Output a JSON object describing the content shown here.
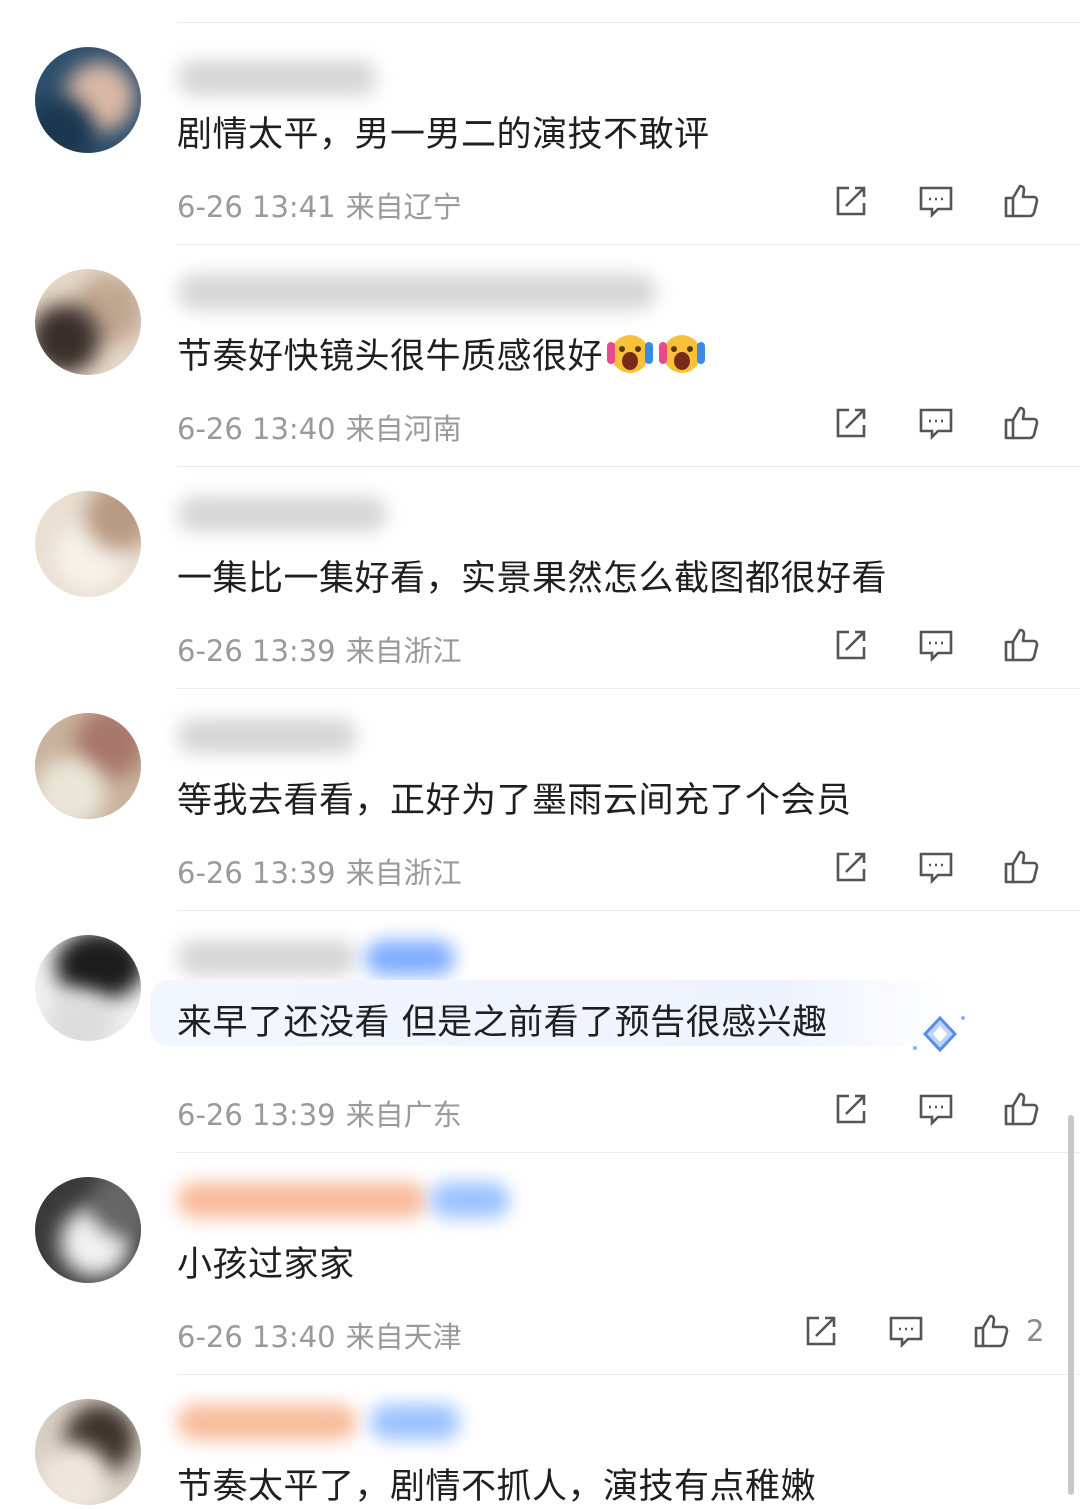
{
  "comments": [
    {
      "text": "剧情太平，男一男二的演技不敢评",
      "time": "6-26 13:41",
      "location": "来自辽宁",
      "likes": ""
    },
    {
      "text": "节奏好快镜头很牛质感很好",
      "time": "6-26 13:40",
      "location": "来自河南",
      "likes": "",
      "emoji": "face-screaming-emoji"
    },
    {
      "text": "一集比一集好看，实景果然怎么截图都很好看",
      "time": "6-26 13:39",
      "location": "来自浙江",
      "likes": ""
    },
    {
      "text": "等我去看看，正好为了墨雨云间充了个会员",
      "time": "6-26 13:39",
      "location": "来自浙江",
      "likes": ""
    },
    {
      "text": "来早了还没看 但是之前看了预告很感兴趣",
      "time": "6-26 13:39",
      "location": "来自广东",
      "likes": ""
    },
    {
      "text": "小孩过家家",
      "time": "6-26 13:40",
      "location": "来自天津",
      "likes": "2"
    },
    {
      "text": "节奏太平了，剧情不抓人，演技有点稚嫩",
      "time": "",
      "location": "",
      "likes": ""
    }
  ],
  "icons": {
    "share": "share-icon",
    "reply": "comment-icon",
    "like": "thumbs-up-icon"
  },
  "colors": {
    "text": "#1f1f1f",
    "meta": "#9a9a9a",
    "icon": "#555555",
    "highlight": "#eef3ff",
    "badge": "#6aa0ff"
  }
}
